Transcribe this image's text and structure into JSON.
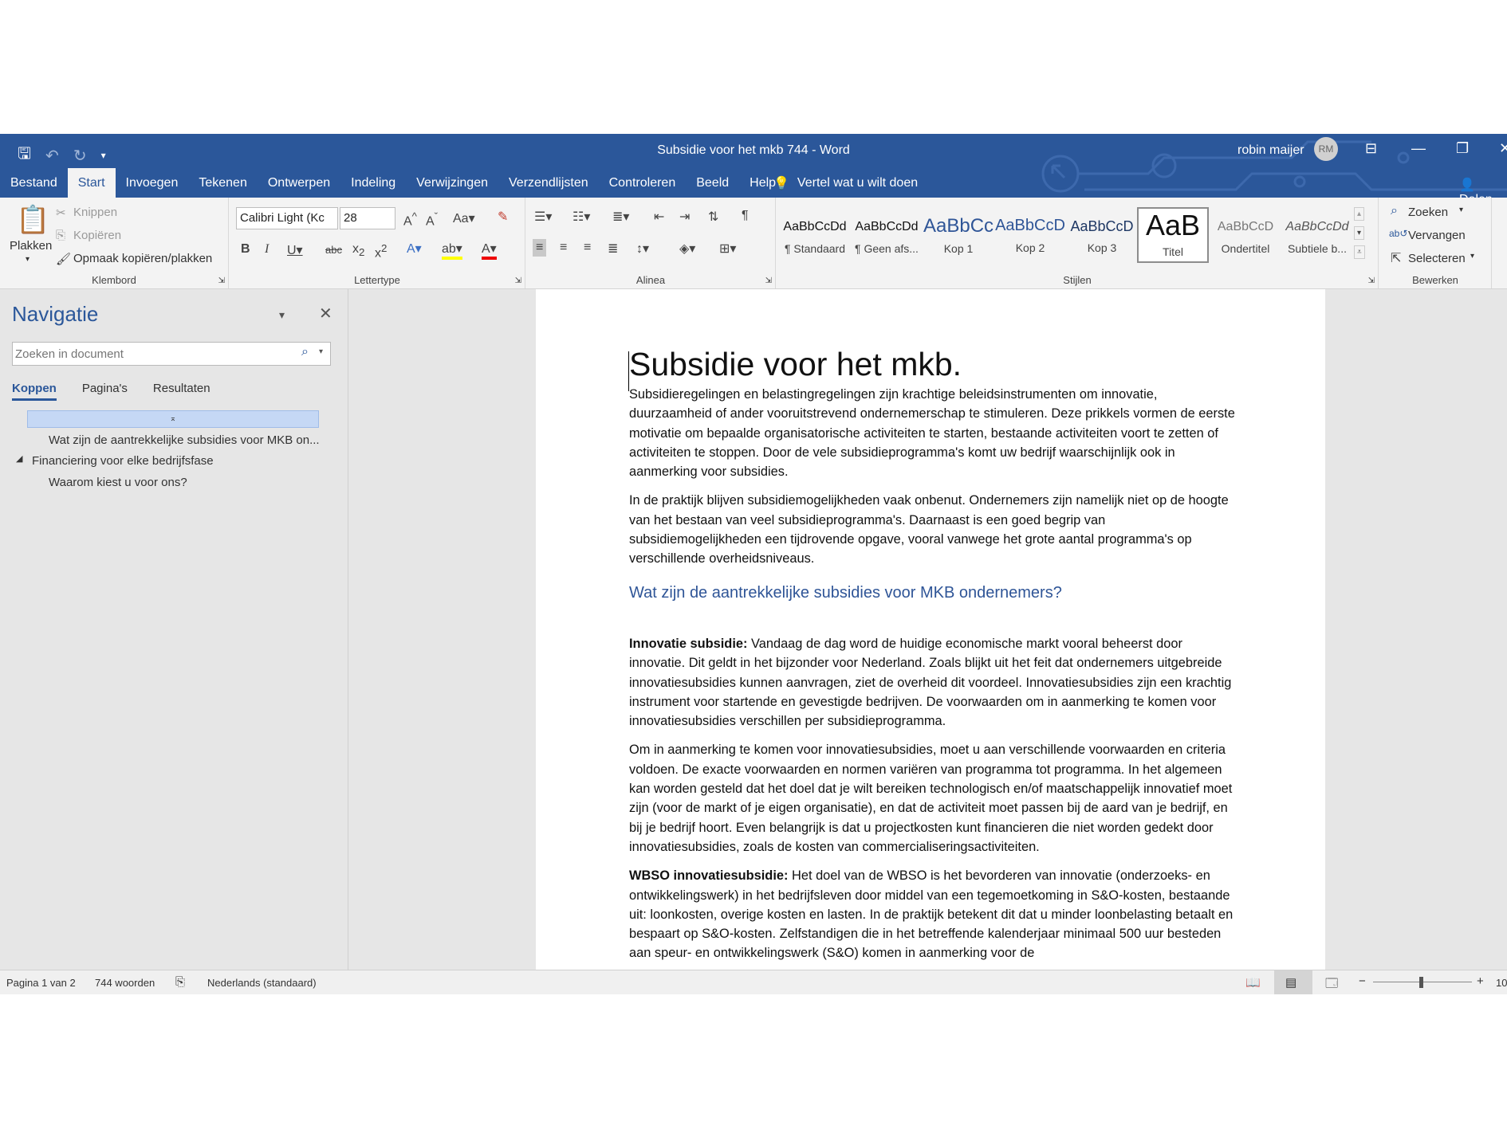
{
  "window": {
    "title": "Subsidie voor het mkb 744  -  Word",
    "user": "robin maijer",
    "avatar": "RM"
  },
  "menu_tabs": [
    "Bestand",
    "Start",
    "Invoegen",
    "Tekenen",
    "Ontwerpen",
    "Indeling",
    "Verwijzingen",
    "Verzendlijsten",
    "Controleren",
    "Beeld",
    "Help"
  ],
  "tell_me": "Vertel wat u wilt doen",
  "share": "Delen",
  "ribbon": {
    "clipboard": {
      "paste": "Plakken",
      "cut": "Knippen",
      "copy": "Kopiëren",
      "format_painter": "Opmaak kopiëren/plakken",
      "label": "Klembord"
    },
    "font": {
      "name": "Calibri Light (Kc",
      "size": "28",
      "label": "Lettertype"
    },
    "paragraph": {
      "label": "Alinea"
    },
    "styles": {
      "label": "Stijlen",
      "items": [
        {
          "preview": "AaBbCcDd",
          "name": "¶ Standaard"
        },
        {
          "preview": "AaBbCcDd",
          "name": "¶ Geen afs..."
        },
        {
          "preview": "AaBbCc",
          "name": "Kop 1"
        },
        {
          "preview": "AaBbCcD",
          "name": "Kop 2"
        },
        {
          "preview": "AaBbCcD",
          "name": "Kop 3"
        },
        {
          "preview": "AaB",
          "name": "Titel"
        },
        {
          "preview": "AaBbCcD",
          "name": "Ondertitel"
        },
        {
          "preview": "AaBbCcDd",
          "name": "Subtiele b..."
        }
      ]
    },
    "editing": {
      "find": "Zoeken",
      "replace": "Vervangen",
      "select": "Selecteren",
      "label": "Bewerken"
    }
  },
  "nav": {
    "title": "Navigatie",
    "search_placeholder": "Zoeken in document",
    "tabs": [
      "Koppen",
      "Pagina's",
      "Resultaten"
    ],
    "headings": [
      "Wat zijn de aantrekkelijke subsidies voor MKB on...",
      "Financiering voor elke bedrijfsfase",
      "Waarom kiest u voor ons?"
    ]
  },
  "document": {
    "title": "Subsidie voor het mkb.",
    "p1": "Subsidieregelingen en belastingregelingen zijn krachtige beleidsinstrumenten om innovatie, duurzaamheid of ander vooruitstrevend ondernemerschap te stimuleren. Deze prikkels vormen de eerste motivatie om bepaalde organisatorische activiteiten te starten, bestaande activiteiten voort te zetten of activiteiten te stoppen. Door de vele subsidieprogramma's komt uw bedrijf waarschijnlijk ook in aanmerking voor subsidies.",
    "p2": "In de praktijk blijven subsidiemogelijkheden vaak onbenut. Ondernemers zijn namelijk niet op de hoogte van het bestaan van veel subsidieprogramma's. Daarnaast is een goed begrip van subsidiemogelijkheden een tijdrovende opgave, vooral vanwege het grote aantal programma's op verschillende overheidsniveaus.",
    "h2": "Wat zijn de aantrekkelijke subsidies voor MKB ondernemers?",
    "p3_bold": "Innovatie subsidie:",
    "p3": " Vandaag de dag word de huidige economische markt vooral beheerst door innovatie. Dit geldt in het bijzonder voor Nederland. Zoals blijkt uit het feit dat ondernemers uitgebreide innovatiesubsidies kunnen aanvragen, ziet de overheid dit voordeel. Innovatiesubsidies zijn een krachtig instrument voor startende en gevestigde bedrijven. De voorwaarden om in aanmerking te komen voor innovatiesubsidies verschillen per subsidieprogramma.",
    "p4": "Om in aanmerking te komen voor innovatiesubsidies, moet u aan verschillende voorwaarden en criteria voldoen. De exacte voorwaarden en normen variëren van programma tot programma. In het algemeen kan worden gesteld dat het doel dat je wilt bereiken technologisch en/of maatschappelijk innovatief moet zijn (voor de markt of je eigen organisatie), en dat de activiteit moet passen bij de aard van je bedrijf, en bij je bedrijf hoort. Even belangrijk is dat u projectkosten kunt financieren die niet worden gedekt door innovatiesubsidies, zoals de kosten van commercialiseringsactiviteiten.",
    "p5_bold": "WBSO innovatiesubsidie:",
    "p5": " Het doel van de WBSO is het bevorderen van innovatie (onderzoeks- en ontwikkelingswerk) in het bedrijfsleven door middel van een tegemoetkoming in S&O-kosten, bestaande uit: loonkosten, overige kosten en lasten. In de praktijk betekent dit dat u minder loonbelasting betaalt en bespaart op S&O-kosten. Zelfstandigen die in het betreffende kalenderjaar minimaal 500 uur besteden aan speur- en ontwikkelingswerk (S&O) komen in aanmerking voor de"
  },
  "status": {
    "page": "Pagina 1 van 2",
    "words": "744 woorden",
    "language": "Nederlands (standaard)",
    "zoom": "10"
  },
  "colors": {
    "accent": "#2b579a",
    "heading2": "#2f5597"
  }
}
